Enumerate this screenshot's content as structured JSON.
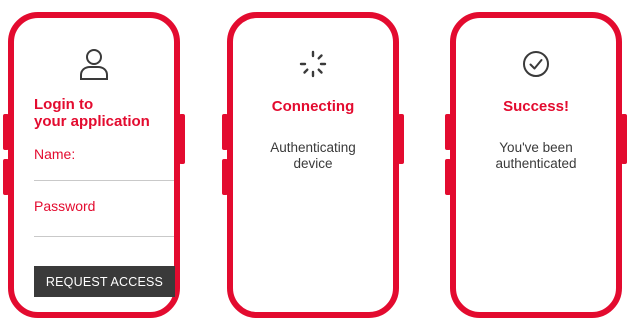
{
  "login": {
    "icon": "user-icon",
    "title_line1": "Login to",
    "title_line2": "your application",
    "name_label": "Name:",
    "password_label": "Password",
    "button_label": "REQUEST ACCESS"
  },
  "connecting": {
    "icon": "loading-spinner-icon",
    "title": "Connecting",
    "message": "Authenticating\ndevice"
  },
  "success": {
    "icon": "check-circle-icon",
    "title": "Success!",
    "message": "You've been\nauthenticated"
  },
  "colors": {
    "accent": "#e30b2f",
    "button_bg": "#3a3a3a",
    "text": "#3a3a3a"
  }
}
